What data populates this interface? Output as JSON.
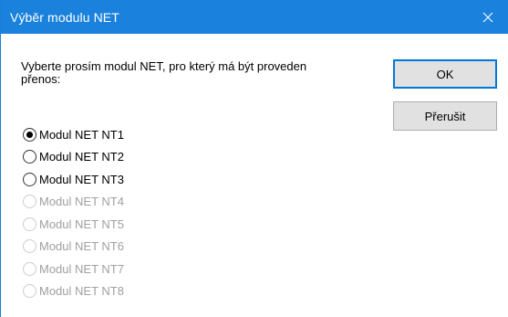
{
  "window": {
    "title": "Výběr modulu NET",
    "close_icon": "close-icon",
    "title_bar_color": "#1a82dc"
  },
  "prompt": {
    "line1": "Vyberte prosím modul NET, pro který má být proveden",
    "line2": "přenos:"
  },
  "buttons": {
    "ok_label": "OK",
    "cancel_label": "Přerušit"
  },
  "options": [
    {
      "label": "Modul NET NT1",
      "checked": true,
      "enabled": true
    },
    {
      "label": "Modul NET NT2",
      "checked": false,
      "enabled": true
    },
    {
      "label": "Modul NET NT3",
      "checked": false,
      "enabled": true
    },
    {
      "label": "Modul NET NT4",
      "checked": false,
      "enabled": false
    },
    {
      "label": "Modul NET NT5",
      "checked": false,
      "enabled": false
    },
    {
      "label": "Modul NET NT6",
      "checked": false,
      "enabled": false
    },
    {
      "label": "Modul NET NT7",
      "checked": false,
      "enabled": false
    },
    {
      "label": "Modul NET NT8",
      "checked": false,
      "enabled": false
    }
  ]
}
